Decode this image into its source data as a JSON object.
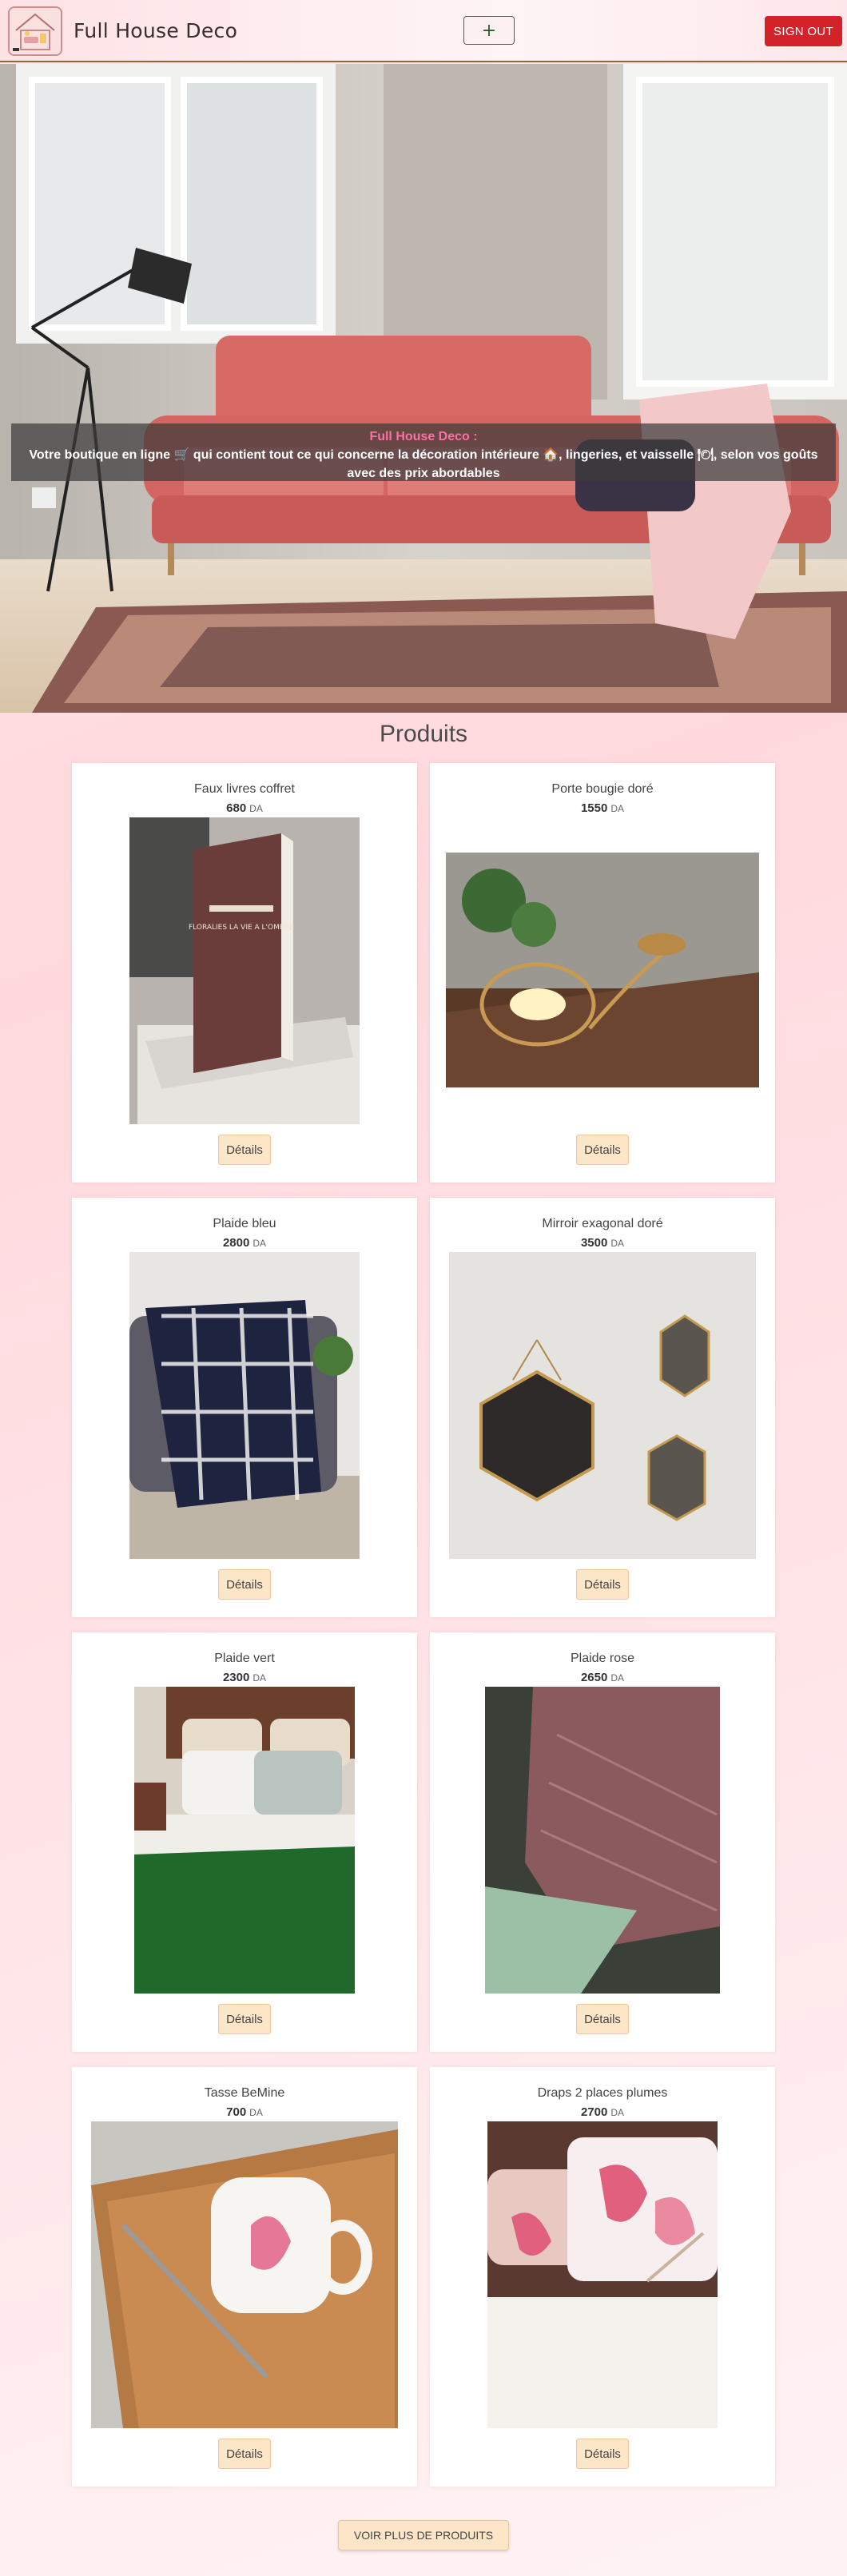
{
  "header": {
    "brand": "Full House Deco",
    "add_label": "+",
    "signout_label": "SIGN OUT"
  },
  "hero": {
    "title": "Full House Deco :",
    "text": "Votre boutique en ligne 🛒 qui contient tout ce qui concerne la décoration intérieure 🏠, lingeries, et vaisselle 🍽, selon vos goûts avec des prix abordables"
  },
  "section": {
    "title": "Produits"
  },
  "products": [
    {
      "name": "Faux livres coffret",
      "price": "680",
      "currency": "DA",
      "details": "Détails"
    },
    {
      "name": "Porte bougie doré",
      "price": "1550",
      "currency": "DA",
      "details": "Détails"
    },
    {
      "name": "Plaide bleu",
      "price": "2800",
      "currency": "DA",
      "details": "Détails"
    },
    {
      "name": "Mirroir exagonal doré",
      "price": "3500",
      "currency": "DA",
      "details": "Détails"
    },
    {
      "name": "Plaide vert",
      "price": "2300",
      "currency": "DA",
      "details": "Détails"
    },
    {
      "name": "Plaide rose",
      "price": "2650",
      "currency": "DA",
      "details": "Détails"
    },
    {
      "name": "Tasse BeMine",
      "price": "700",
      "currency": "DA",
      "details": "Détails"
    },
    {
      "name": "Draps 2 places plumes",
      "price": "2700",
      "currency": "DA",
      "details": "Détails"
    }
  ],
  "book_cover_text": "FLORALIES LA VIE A L'OMBRE",
  "more_label": "VOIR PLUS DE PRODUITS",
  "colors": {
    "accent_red": "#d3222a",
    "button_beige": "#fde6c8",
    "hero_title_pink": "#ff6fa0"
  }
}
